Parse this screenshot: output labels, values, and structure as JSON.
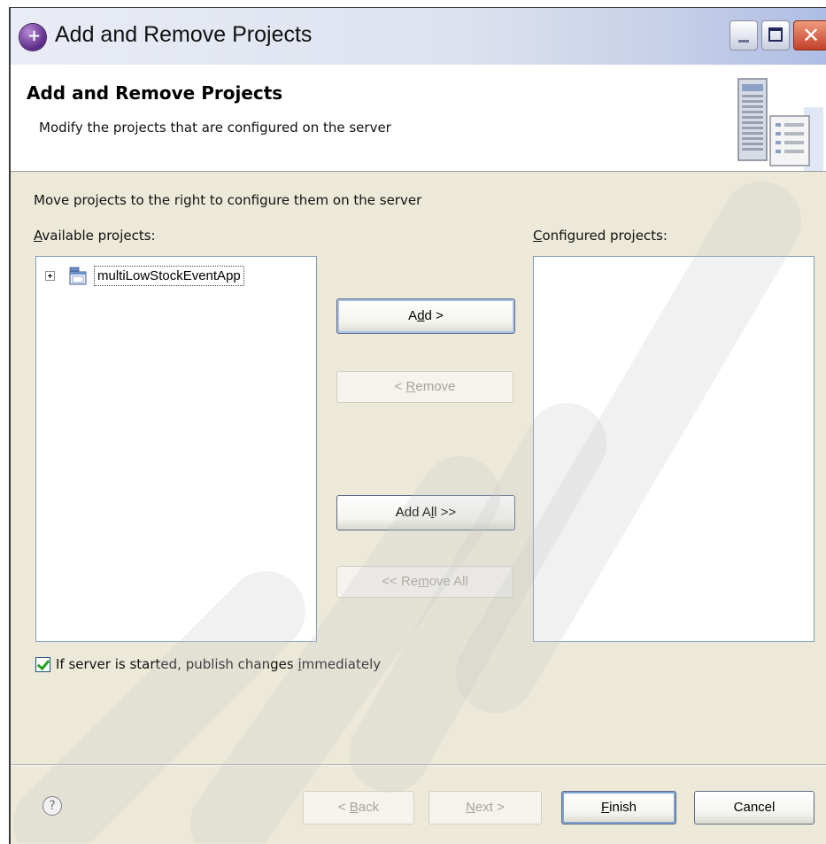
{
  "window": {
    "title": "Add and Remove Projects",
    "icon": "eclipse-app-icon"
  },
  "banner": {
    "title": "Add and Remove Projects",
    "description": "Modify the projects that are configured on the server",
    "graphic": "server-config-graphic"
  },
  "main": {
    "instruction": "Move projects to the right to configure them on the server",
    "available_label": "Available projects:",
    "configured_label": "Configured projects:",
    "available_items": [
      {
        "label": "multiLowStockEventApp",
        "expanded": false,
        "icon": "enterprise-app-icon"
      }
    ],
    "configured_items": []
  },
  "buttons": {
    "add": "Add >",
    "remove": "< Remove",
    "add_all": "Add All >>",
    "remove_all": "<< Remove All"
  },
  "options": {
    "publish_label": "If server is started, publish changes immediately",
    "publish_checked": true
  },
  "footer": {
    "back": "< Back",
    "next": "Next >",
    "finish": "Finish",
    "cancel": "Cancel",
    "help_icon": "help-icon"
  },
  "colors": {
    "dialog_bg": "#ece9d8",
    "banner_bg": "#ffffff",
    "list_border": "#7f9db9",
    "check_green": "#21a121"
  }
}
